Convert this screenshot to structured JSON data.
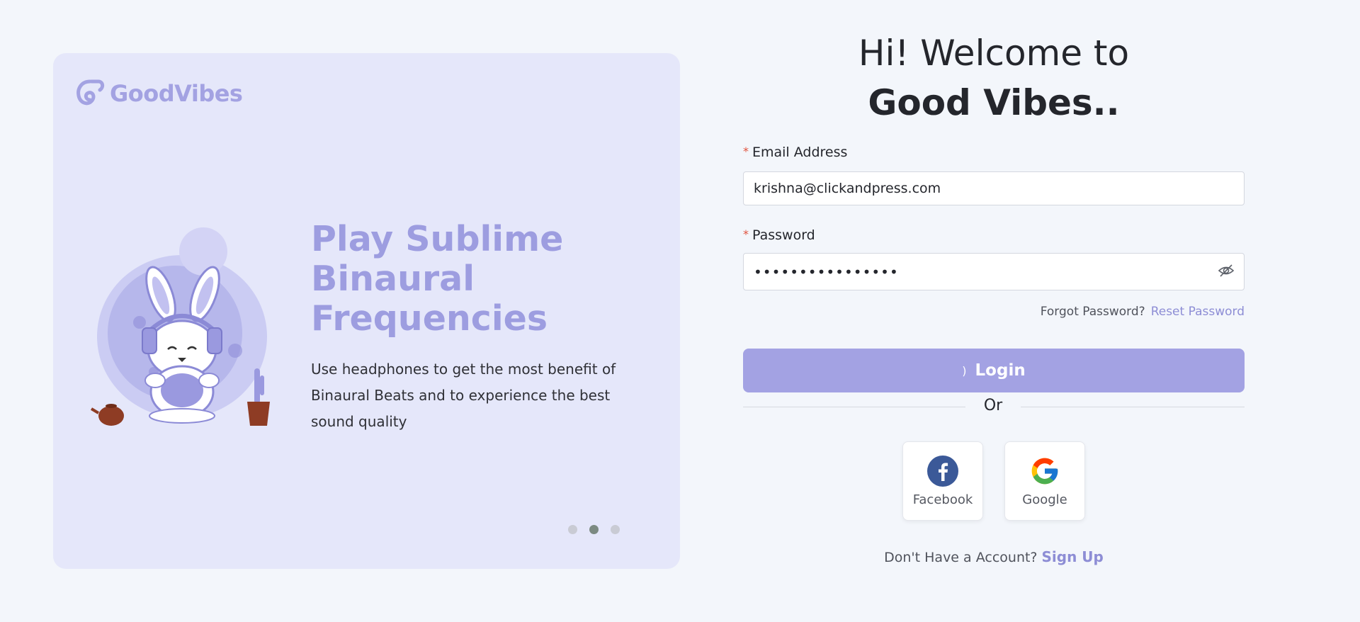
{
  "brand": {
    "logo_text": "GoodVibes"
  },
  "promo": {
    "title": "Play Sublime Binaural Frequencies",
    "description": "Use headphones to get the most benefit of Binaural Beats and to experience the best sound quality",
    "active_slide": 2,
    "slide_count": 3
  },
  "welcome": {
    "line1": "Hi! Welcome to",
    "line2": "Good Vibes.."
  },
  "form": {
    "email_label": "Email Address",
    "email_value": "krishna@clickandpress.com",
    "password_label": "Password",
    "password_value": "••••••••••••••••",
    "forgot_text": "Forgot Password?",
    "reset_link": "Reset Password",
    "login_label": "Login",
    "or_text": "Or"
  },
  "social": {
    "facebook_label": "Facebook",
    "google_label": "Google"
  },
  "signup": {
    "prompt": "Don't Have a Account?",
    "link": "Sign Up"
  },
  "colors": {
    "accent": "#a3a2e3",
    "link": "#8d8dd5",
    "card_bg": "#e5e7fa",
    "page_bg": "#f3f6fb",
    "required": "#e0533f"
  }
}
